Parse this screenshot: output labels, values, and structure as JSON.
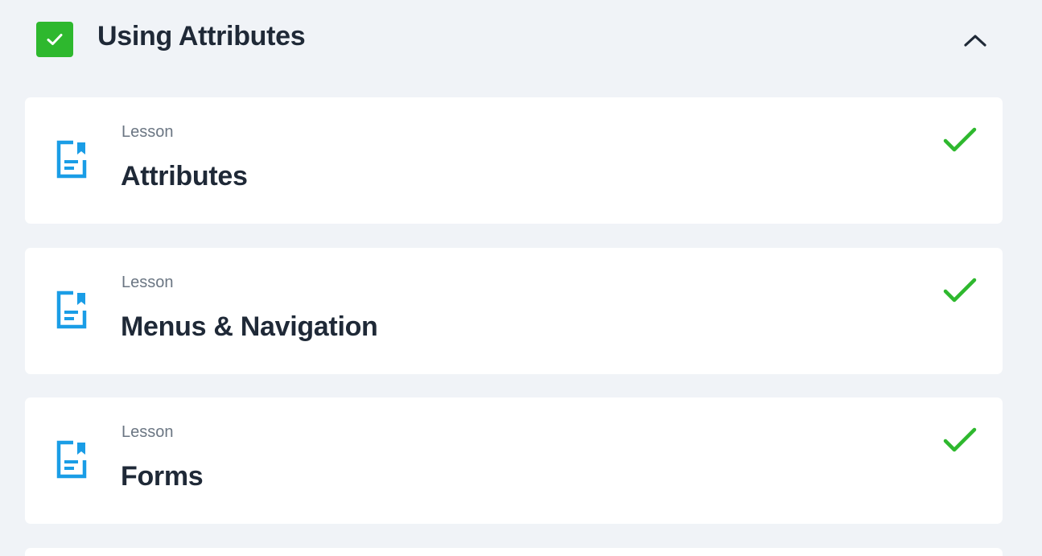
{
  "section": {
    "title": "Using Attributes",
    "completed": true,
    "expanded": true,
    "icons": {
      "status": "checkbox-checked-icon",
      "toggle": "chevron-up-icon"
    }
  },
  "lessons": [
    {
      "type": "Lesson",
      "title": "Attributes",
      "completed": true
    },
    {
      "type": "Lesson",
      "title": "Menus & Navigation",
      "completed": true
    },
    {
      "type": "Lesson",
      "title": "Forms",
      "completed": true
    }
  ],
  "icons": {
    "lesson": "lesson-document-icon",
    "complete": "checkmark-icon"
  },
  "colors": {
    "background": "#f0f3f7",
    "card": "#ffffff",
    "success": "#2eb82e",
    "lesson_icon": "#1a9de6",
    "title_text": "#1f2937",
    "label_text": "#6b7683"
  }
}
